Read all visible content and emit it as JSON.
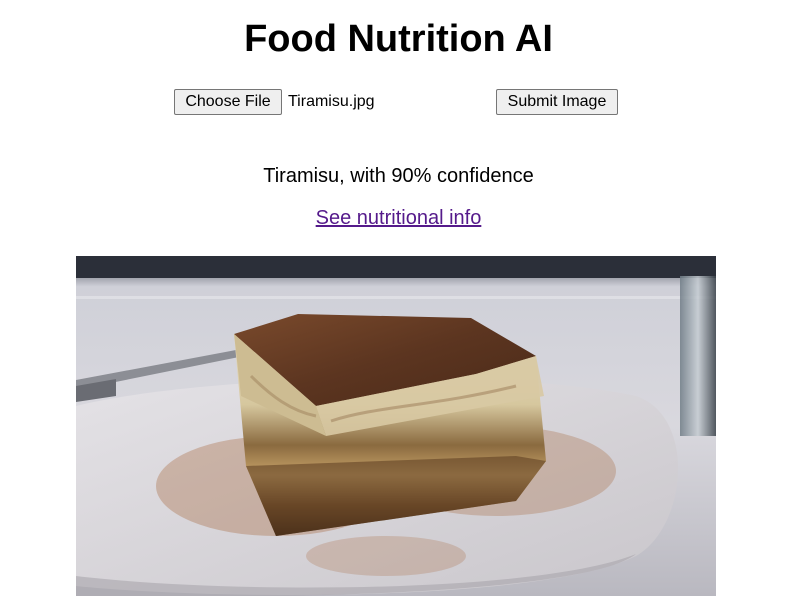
{
  "page": {
    "title": "Food Nutrition AI"
  },
  "upload": {
    "choose_label": "Choose File",
    "file_name": "Tiramisu.jpg",
    "submit_label": "Submit Image"
  },
  "result": {
    "prediction": "Tiramisu, with 90% confidence",
    "link_text": "See nutritional info"
  },
  "colors": {
    "link_visited": "#551a8b",
    "button_bg": "#efefef"
  }
}
